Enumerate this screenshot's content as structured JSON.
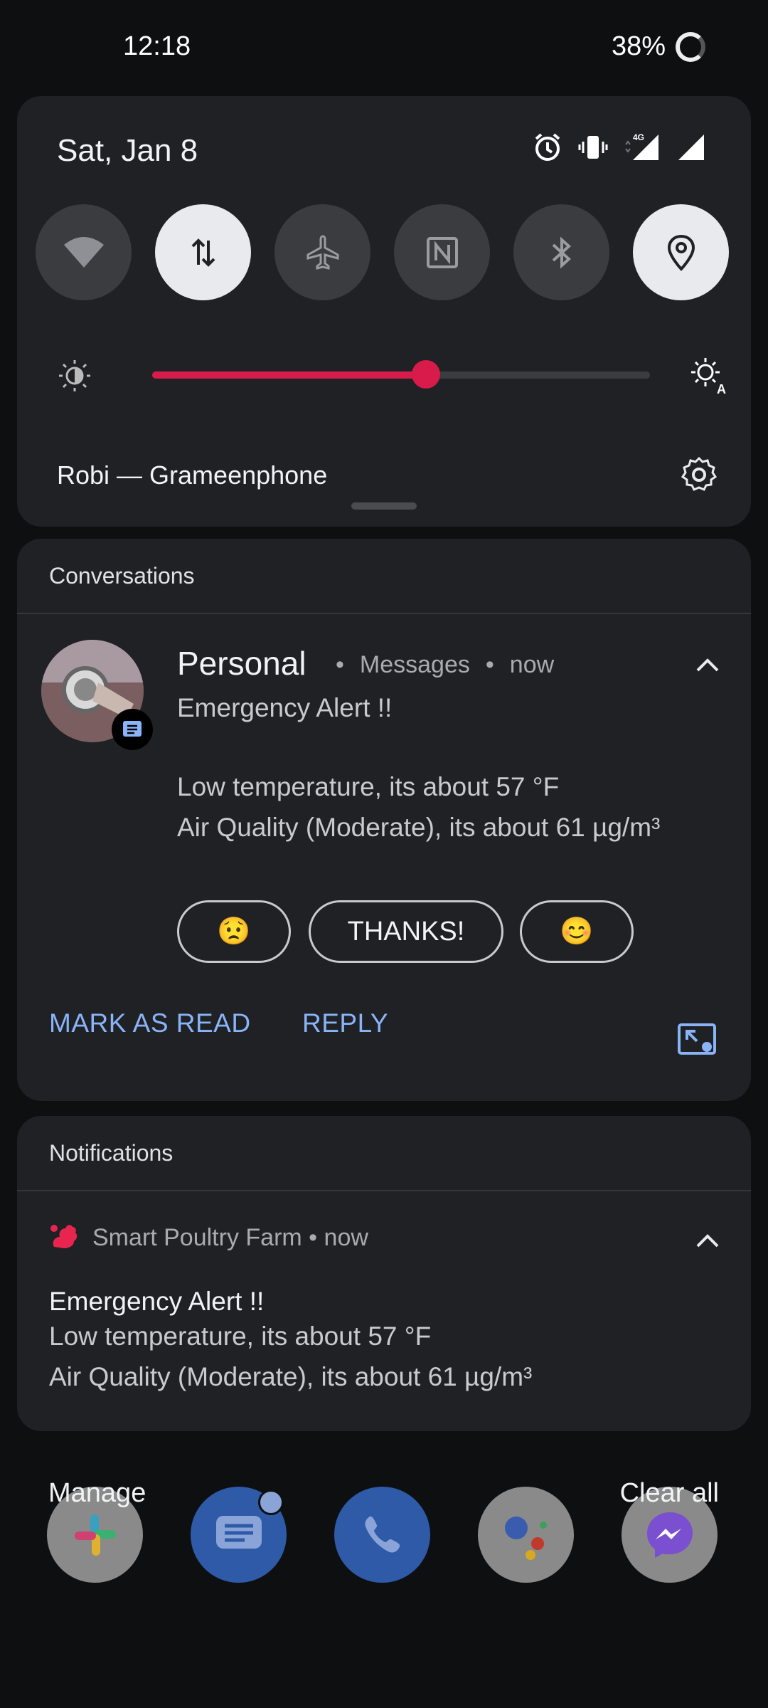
{
  "status_bar": {
    "time": "12:18",
    "battery": "38%"
  },
  "quick_settings": {
    "date": "Sat, Jan 8",
    "network_label": "4G",
    "tiles": [
      {
        "name": "wifi",
        "active": false
      },
      {
        "name": "mobile-data",
        "active": true
      },
      {
        "name": "airplane-mode",
        "active": false
      },
      {
        "name": "nfc",
        "active": false
      },
      {
        "name": "bluetooth",
        "active": false
      },
      {
        "name": "location",
        "active": true
      }
    ],
    "brightness_level": 0.55,
    "carrier": "Robi — Grameenphone"
  },
  "conversations": {
    "header": "Conversations",
    "sender": "Personal",
    "app": "Messages",
    "time": "now",
    "title": "Emergency Alert !!",
    "line1": "Low temperature, its about 57 °F",
    "line2": "Air Quality (Moderate), its about 61 µg/m³",
    "replies": [
      "😟",
      "THANKS!",
      "😊"
    ],
    "actions": {
      "mark_read": "MARK AS READ",
      "reply": "REPLY"
    }
  },
  "notifications": {
    "header": "Notifications",
    "app": "Smart Poultry Farm",
    "time": "now",
    "title": "Emergency Alert !!",
    "line1": "Low temperature, its about 57 °F",
    "line2": "Air Quality (Moderate), its about 61 µg/m³"
  },
  "bottom": {
    "manage": "Manage",
    "clear_all": "Clear all"
  },
  "colors": {
    "accent": "#d81b4a",
    "link": "#8ab4f8",
    "panel": "#1f2125"
  }
}
